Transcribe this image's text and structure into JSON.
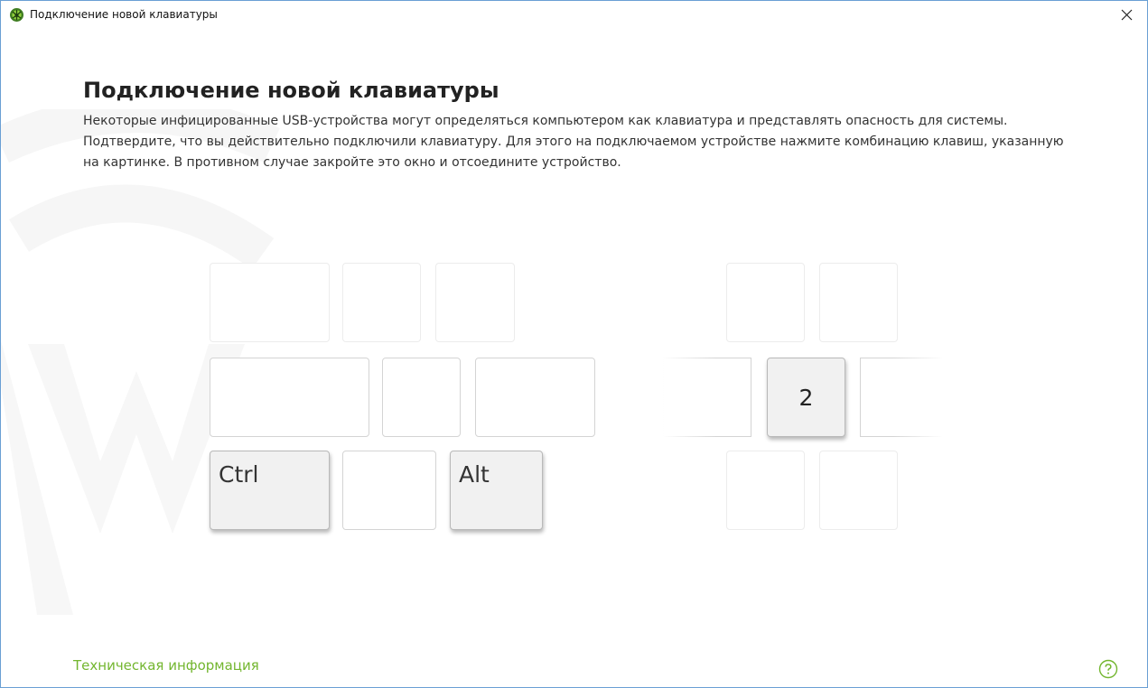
{
  "window": {
    "title": "Подключение новой клавиатуры",
    "close_glyph": "✕",
    "icon": "drweb-spider-icon"
  },
  "main": {
    "heading": "Подключение новой клавиатуры",
    "paragraph1": "Некоторые инфицированные USB-устройства могут определяться компьютером как клавиатура и представлять опасность для системы.",
    "paragraph2": "Подтвердите, что вы действительно подключили клавиатуру. Для этого на подключаемом устройстве нажмите комбинацию клавиш, указанную на картинке. В противном случае закройте это окно и отсоедините устройство."
  },
  "keyboard": {
    "ctrl_label": "Ctrl",
    "alt_label": "Alt",
    "digit_label": "2"
  },
  "footer": {
    "tech_info_link": "Техническая информация",
    "help_icon": "help-circle-icon"
  },
  "colors": {
    "accent_green": "#73b62f",
    "window_border": "#6a9fd4"
  }
}
